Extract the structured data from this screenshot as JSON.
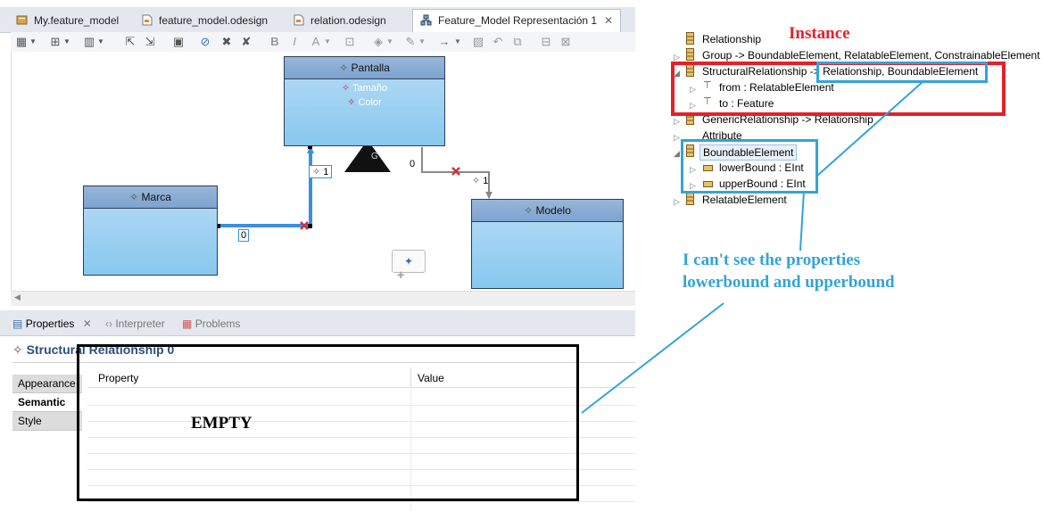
{
  "editor_tabs": [
    {
      "label": "My.feature_model"
    },
    {
      "label": "feature_model.odesign"
    },
    {
      "label": "relation.odesign"
    },
    {
      "label": "Feature_Model Representación 1",
      "active": true
    }
  ],
  "diagram": {
    "classes": [
      {
        "name": "Pantalla",
        "attrs": [
          "Tamaño",
          "Color"
        ]
      },
      {
        "name": "Marca"
      },
      {
        "name": "Modelo"
      }
    ],
    "edge_labels": [
      "1",
      "0",
      "0",
      "1"
    ],
    "triangle_label": "G"
  },
  "bottom_tabs": [
    {
      "label": "Properties"
    },
    {
      "label": "Interpreter"
    },
    {
      "label": "Problems"
    }
  ],
  "properties": {
    "title": "Structural Relationship 0",
    "side_tabs": [
      "Appearance",
      "Semantic",
      "Style"
    ],
    "columns": [
      "Property",
      "Value"
    ],
    "empty_note": "EMPTY"
  },
  "tree": [
    {
      "label": "Relationship"
    },
    {
      "label": "Group -> BoundableElement, RelatableElement, ConstrainableElement"
    },
    {
      "label": "StructuralRelationship -> ",
      "extra": "Relationship, BoundableElement"
    },
    {
      "label": "from : RelatableElement"
    },
    {
      "label": "to : Feature"
    },
    {
      "label": "GenericRelationship -> Relationship"
    },
    {
      "label": "Attribute"
    },
    {
      "label": "BoundableElement"
    },
    {
      "label": "lowerBound : EInt"
    },
    {
      "label": "upperBound : EInt"
    },
    {
      "label": "RelatableElement"
    }
  ],
  "annotations": {
    "instance": "Instance",
    "note_line1": "I can't see the properties",
    "note_line2": "lowerbound and upperbound"
  },
  "colors": {
    "annotation_red": "#e5202a",
    "annotation_blue": "#33a3d8",
    "edge_blue": "#3a8fe0"
  }
}
